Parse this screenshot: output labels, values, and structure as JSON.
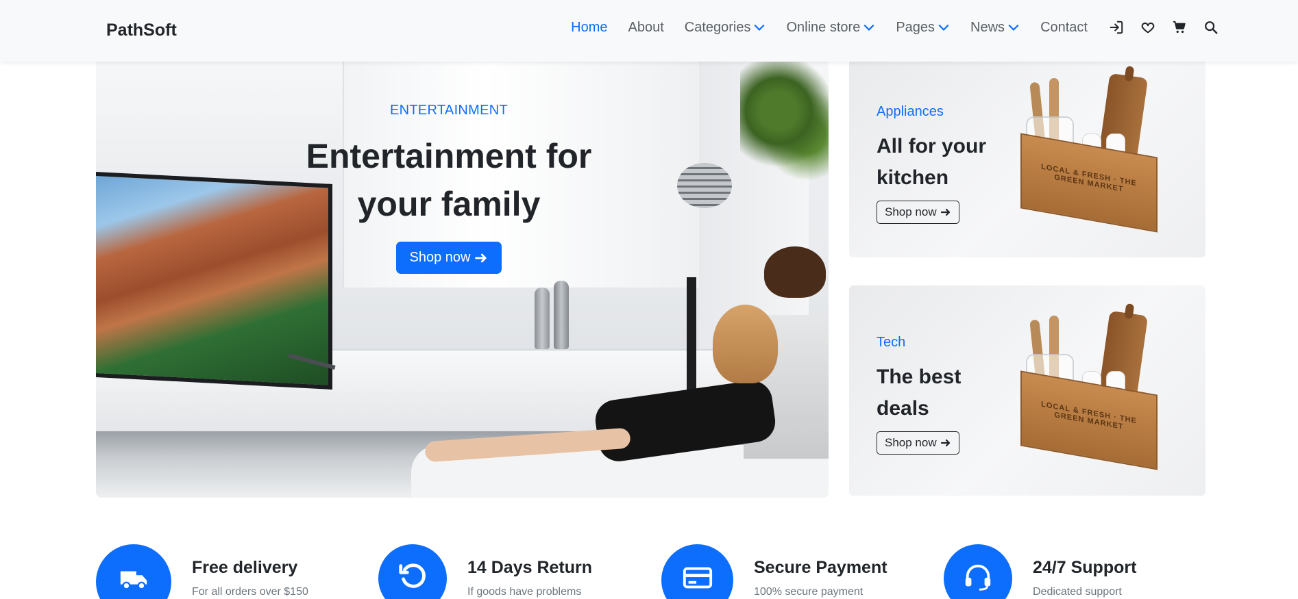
{
  "navbar": {
    "brand": "PathSoft",
    "links": [
      {
        "label": "Home",
        "active": true,
        "dropdown": false
      },
      {
        "label": "About",
        "active": false,
        "dropdown": false
      },
      {
        "label": "Categories",
        "active": false,
        "dropdown": true
      },
      {
        "label": "Online store",
        "active": false,
        "dropdown": true
      },
      {
        "label": "Pages",
        "active": false,
        "dropdown": true
      },
      {
        "label": "News",
        "active": false,
        "dropdown": true
      },
      {
        "label": "Contact",
        "active": false,
        "dropdown": false
      }
    ],
    "icons": [
      "login-icon",
      "heart-icon",
      "cart-icon",
      "search-icon"
    ]
  },
  "hero": {
    "eyebrow": "ENTERTAINMENT",
    "title": "Entertainment for your family",
    "button": "Shop now"
  },
  "cards": [
    {
      "category": "Appliances",
      "title": "All for your kitchen",
      "button": "Shop now",
      "image_text": "LOCAL & FRESH · THE GREEN MARKET"
    },
    {
      "category": "Tech",
      "title": "The best deals",
      "button": "Shop now",
      "image_text": "LOCAL & FRESH · THE GREEN MARKET"
    }
  ],
  "features": [
    {
      "icon": "truck-icon",
      "title": "Free delivery",
      "subtitle": "For all orders over $150"
    },
    {
      "icon": "return-icon",
      "title": "14 Days Return",
      "subtitle": "If goods have problems"
    },
    {
      "icon": "credit-card-icon",
      "title": "Secure Payment",
      "subtitle": "100% secure payment"
    },
    {
      "icon": "headset-icon",
      "title": "24/7 Support",
      "subtitle": "Dedicated support"
    }
  ],
  "colors": {
    "accent": "#0d6efd",
    "text": "#212529",
    "muted": "#6c757d",
    "navbar_bg": "#f8f9fa"
  }
}
